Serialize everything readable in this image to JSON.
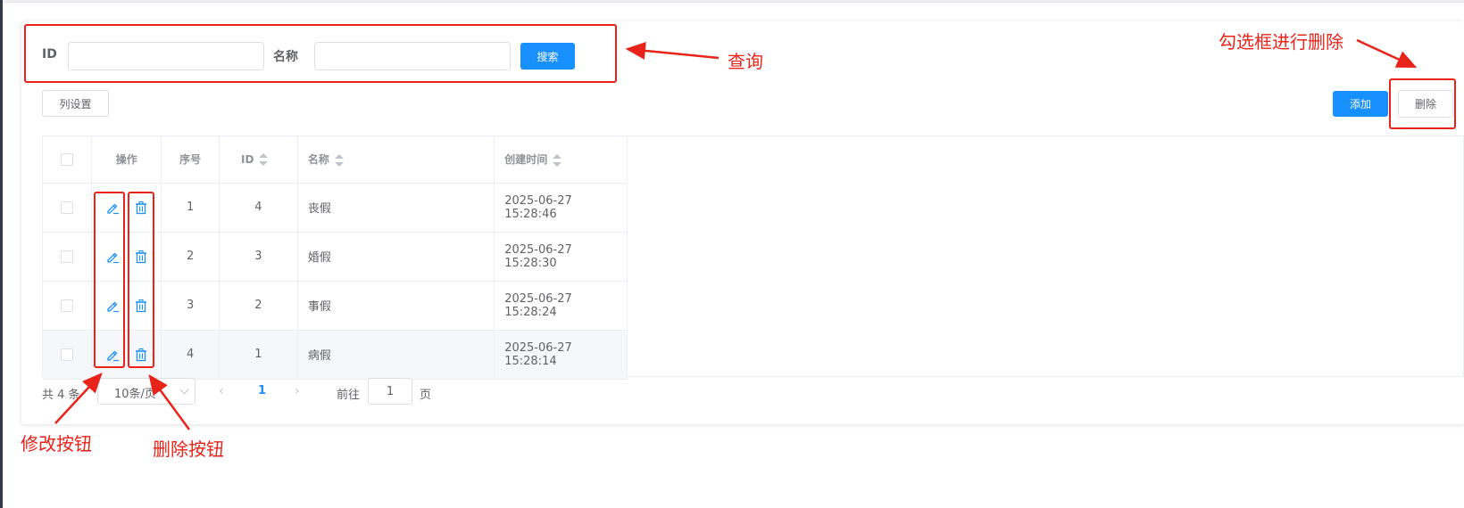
{
  "search": {
    "id_label": "ID",
    "id_value": "",
    "name_label": "名称",
    "name_value": "",
    "search_button": "搜索"
  },
  "toolbar": {
    "columns_button": "列设置",
    "add_button": "添加",
    "delete_button": "删除"
  },
  "table": {
    "headers": {
      "operation": "操作",
      "seq": "序号",
      "id": "ID",
      "name": "名称",
      "created": "创建时间"
    },
    "rows": [
      {
        "seq": "1",
        "id": "4",
        "name": "丧假",
        "created": "2025-06-27 15:28:46"
      },
      {
        "seq": "2",
        "id": "3",
        "name": "婚假",
        "created": "2025-06-27 15:28:30"
      },
      {
        "seq": "3",
        "id": "2",
        "name": "事假",
        "created": "2025-06-27 15:28:24"
      },
      {
        "seq": "4",
        "id": "1",
        "name": "病假",
        "created": "2025-06-27 15:28:14"
      }
    ]
  },
  "pagination": {
    "total": "共 4 条",
    "page_size": "10条/页",
    "current_page": "1",
    "goto_label": "前往",
    "goto_value": "1",
    "goto_unit": "页"
  },
  "annotations": {
    "query": "查询",
    "checkbox_delete": "勾选框进行删除",
    "edit_button": "修改按钮",
    "delete_button": "删除按钮"
  },
  "colors": {
    "primary": "#1890ff",
    "annotation": "#e8241a",
    "border": "#ebeef5"
  },
  "icons": {
    "edit": "edit-icon",
    "delete": "trash-icon",
    "prev": "chevron-left-icon",
    "next": "chevron-right-icon",
    "sort": "sort-caret-icon"
  }
}
